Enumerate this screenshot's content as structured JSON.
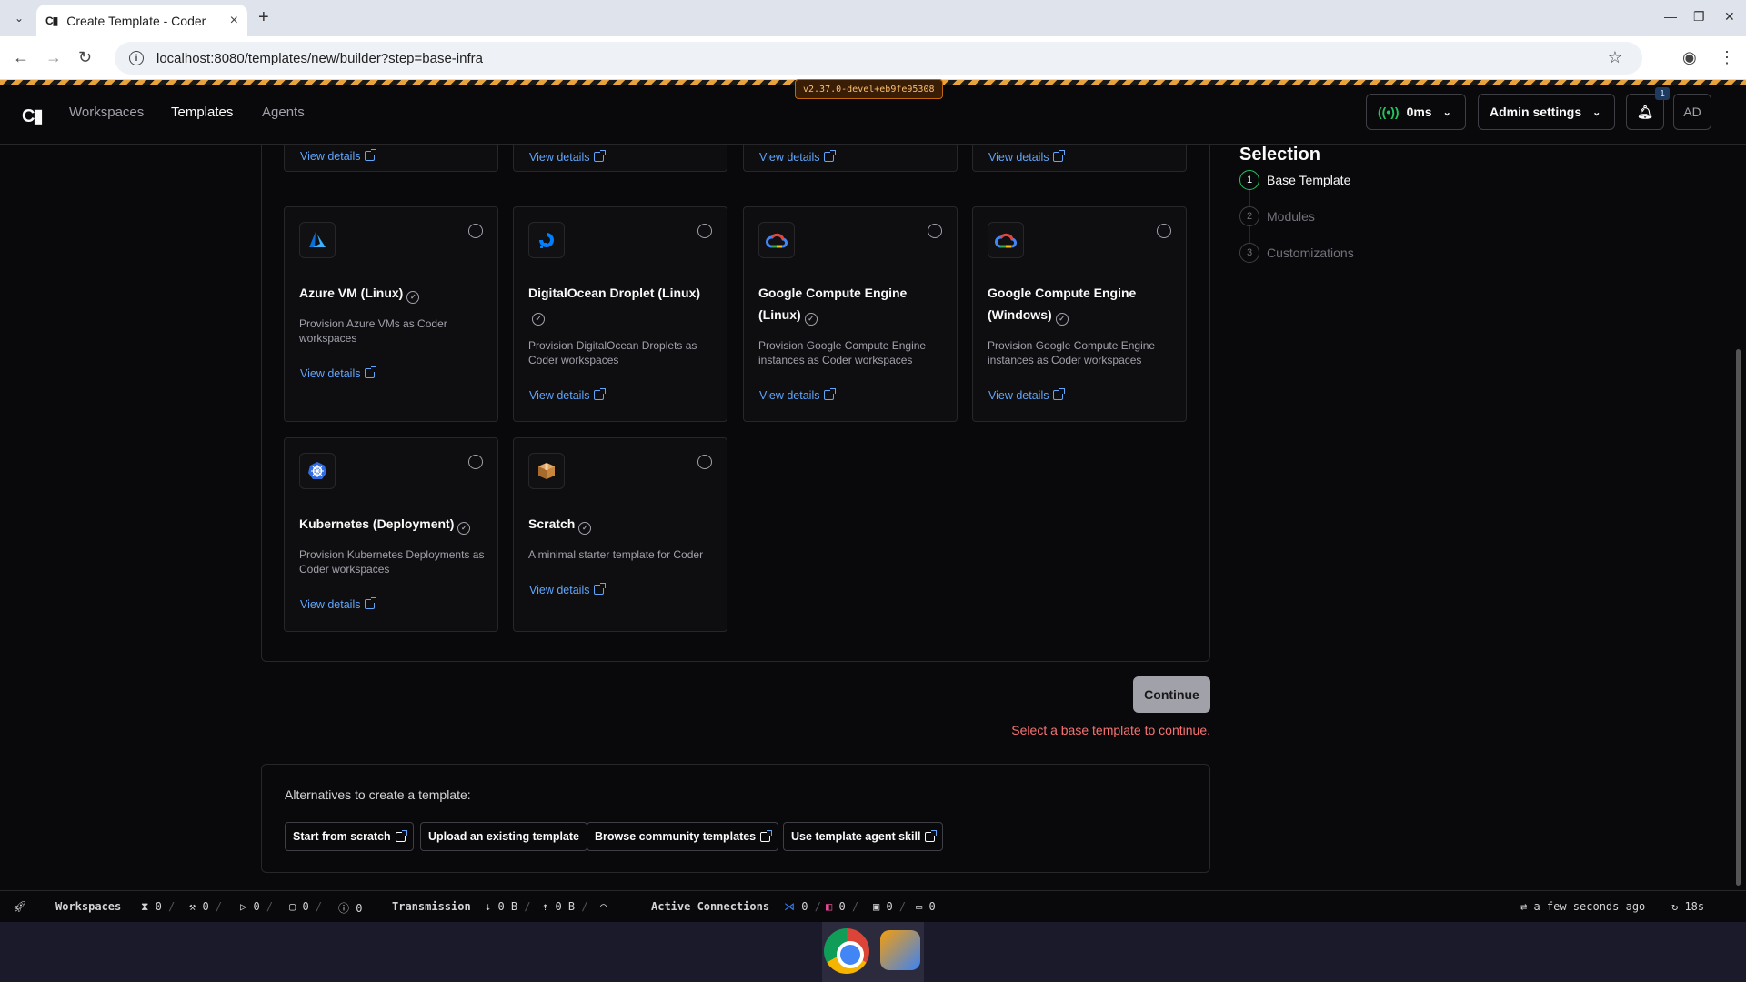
{
  "browser": {
    "tab_title": "Create Template - Coder",
    "tab_favicon": "C▮",
    "url": "localhost:8080/templates/new/builder?step=base-infra"
  },
  "header": {
    "logo": "C▮",
    "nav": [
      "Workspaces",
      "Templates",
      "Agents"
    ],
    "version": "v2.37.0-devel+eb9fe95308",
    "latency": "0ms",
    "admin": "Admin settings",
    "notif_count": "1",
    "avatar": "AD"
  },
  "top_row_links": [
    "View details",
    "View details",
    "View details",
    "View details"
  ],
  "cards": [
    {
      "title": "Azure VM (Linux)",
      "desc": "Provision Azure VMs as Coder workspaces",
      "link": "View details",
      "icon": "azure-icon"
    },
    {
      "title": "DigitalOcean Droplet (Linux)",
      "desc": "Provision DigitalOcean Droplets as Coder workspaces",
      "link": "View details",
      "icon": "digitalocean-icon"
    },
    {
      "title": "Google Compute Engine (Linux)",
      "desc": "Provision Google Compute Engine instances as Coder workspaces",
      "link": "View details",
      "icon": "google-cloud-icon"
    },
    {
      "title": "Google Compute Engine (Windows)",
      "desc": "Provision Google Compute Engine instances as Coder workspaces",
      "link": "View details",
      "icon": "google-cloud-icon"
    },
    {
      "title": "Kubernetes (Deployment)",
      "desc": "Provision Kubernetes Deployments as Coder workspaces",
      "link": "View details",
      "icon": "kubernetes-icon"
    },
    {
      "title": "Scratch",
      "desc": "A minimal starter template for Coder",
      "link": "View details",
      "icon": "box-icon"
    }
  ],
  "actions": {
    "continue": "Continue",
    "error": "Select a base template to continue."
  },
  "alternatives": {
    "title": "Alternatives to create a template:",
    "buttons": [
      "Start from scratch",
      "Upload an existing template",
      "Browse community templates",
      "Use template agent skill"
    ]
  },
  "selection": {
    "title": "Selection",
    "steps": [
      {
        "num": "1",
        "label": "Base Template"
      },
      {
        "num": "2",
        "label": "Modules"
      },
      {
        "num": "3",
        "label": "Customizations"
      }
    ]
  },
  "statusbar": {
    "workspaces": "Workspaces",
    "ws_counts": [
      "0",
      "0",
      "0",
      "0",
      "0"
    ],
    "transmission": "Transmission",
    "tx": [
      "0 B",
      "0 B",
      "-"
    ],
    "active_connections": "Active Connections",
    "conn_counts": [
      "0",
      "0",
      "0",
      "0"
    ],
    "updated": "a few seconds ago",
    "refresh": "18s"
  }
}
